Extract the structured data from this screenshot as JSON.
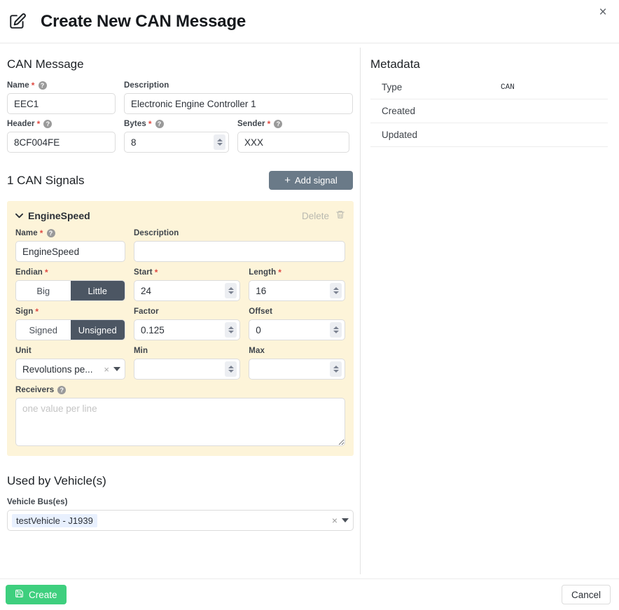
{
  "header": {
    "title": "Create New CAN Message",
    "edit_icon": "edit-pencil-icon",
    "close_label": "×"
  },
  "message_section": {
    "title": "CAN Message",
    "fields": {
      "name": {
        "label": "Name",
        "required": true,
        "help": "?",
        "value": "EEC1"
      },
      "description": {
        "label": "Description",
        "required": false,
        "value": "Electronic Engine Controller 1"
      },
      "header": {
        "label": "Header",
        "required": true,
        "help": "?",
        "value": "8CF004FE"
      },
      "bytes": {
        "label": "Bytes",
        "required": true,
        "help": "?",
        "value": "8"
      },
      "sender": {
        "label": "Sender",
        "required": true,
        "help": "?",
        "value": "XXX"
      }
    }
  },
  "signals_section": {
    "title": "1 CAN Signals",
    "add_button": {
      "label": "Add signal",
      "plus": "+"
    },
    "signal": {
      "name_header": "EngineSpeed",
      "chevron": "⌄",
      "delete_label": "Delete",
      "delete_icon": "trash-icon",
      "fields": {
        "name": {
          "label": "Name",
          "required": true,
          "help": "?",
          "value": "EngineSpeed"
        },
        "description": {
          "label": "Description",
          "required": false,
          "value": ""
        },
        "endian": {
          "label": "Endian",
          "required": true,
          "options": [
            "Big",
            "Little"
          ],
          "selected": "Little"
        },
        "start": {
          "label": "Start",
          "required": true,
          "value": "24"
        },
        "length": {
          "label": "Length",
          "required": true,
          "value": "16"
        },
        "sign": {
          "label": "Sign",
          "required": true,
          "options": [
            "Signed",
            "Unsigned"
          ],
          "selected": "Unsigned"
        },
        "factor": {
          "label": "Factor",
          "required": false,
          "value": "0.125"
        },
        "offset": {
          "label": "Offset",
          "required": false,
          "value": "0"
        },
        "unit": {
          "label": "Unit",
          "required": false,
          "value": "Revolutions pe...",
          "clear": "×"
        },
        "min": {
          "label": "Min",
          "required": false,
          "value": ""
        },
        "max": {
          "label": "Max",
          "required": false,
          "value": ""
        },
        "receivers": {
          "label": "Receivers",
          "help": "?",
          "value": "",
          "placeholder": "one value per line"
        }
      }
    }
  },
  "vehicles_section": {
    "title": "Used by Vehicle(s)",
    "bus_label": "Vehicle Bus(es)",
    "chips": [
      "testVehicle - J1939"
    ],
    "clear": "×"
  },
  "metadata": {
    "title": "Metadata",
    "rows": [
      {
        "key": "Type",
        "value": "CAN"
      },
      {
        "key": "Created",
        "value": ""
      },
      {
        "key": "Updated",
        "value": ""
      }
    ]
  },
  "footer": {
    "create_label": "Create",
    "create_icon": "save-disk-icon",
    "cancel_label": "Cancel"
  },
  "colors": {
    "accent_green": "#3ecf7e",
    "slate_button": "#6a7a88",
    "toggle_active": "#4c5663",
    "signal_panel": "#fdf4d9",
    "chip_bg": "#e8f0fe",
    "required_red": "#e04a42"
  }
}
